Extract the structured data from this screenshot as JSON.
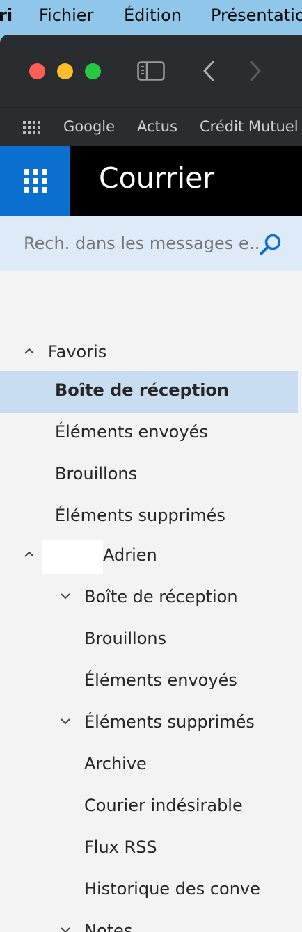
{
  "menubar": {
    "items": [
      "ri",
      "Fichier",
      "Édition",
      "Présentation"
    ]
  },
  "browser": {
    "bookmarks": [
      "Google",
      "Actus",
      "Crédit Mutuel"
    ]
  },
  "app": {
    "title": "Courrier"
  },
  "search": {
    "placeholder": "Rech. dans les messages e…"
  },
  "folders": {
    "favorites": {
      "label": "Favoris",
      "items": [
        "Boîte de réception",
        "Éléments envoyés",
        "Brouillons",
        "Éléments supprimés"
      ],
      "selected": "Boîte de réception"
    },
    "account": {
      "label": "Adrien",
      "items": [
        {
          "label": "Boîte de réception",
          "chevron": "down"
        },
        {
          "label": "Brouillons"
        },
        {
          "label": "Éléments envoyés"
        },
        {
          "label": "Éléments supprimés",
          "chevron": "down"
        },
        {
          "label": "Archive"
        },
        {
          "label": "Courier indésirable"
        },
        {
          "label": "Flux RSS"
        },
        {
          "label": "Historique des conve"
        },
        {
          "label": "Notes",
          "chevron": "down"
        }
      ]
    }
  },
  "colors": {
    "accent": "#0a6fcf",
    "selected_bg": "#c8ddf0",
    "search_bg": "#deeaf7",
    "menubar": "#8fc6ea"
  }
}
